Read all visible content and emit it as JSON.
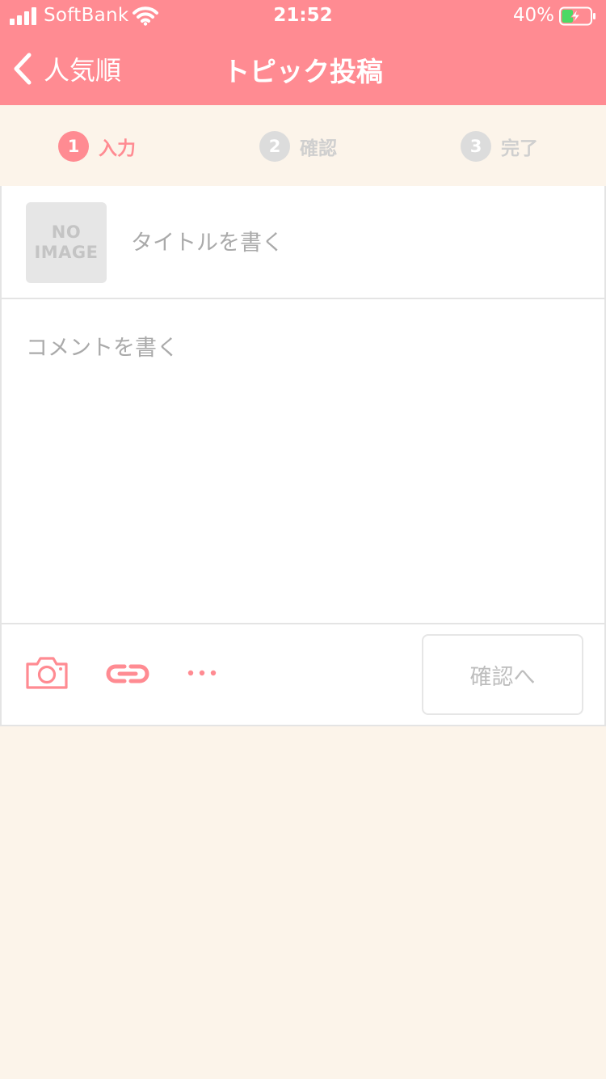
{
  "status_bar": {
    "carrier": "SoftBank",
    "time": "21:52",
    "battery_percent": "40%",
    "battery_level": 0.4,
    "charging": true
  },
  "nav": {
    "back_label": "人気順",
    "title": "トピック投稿"
  },
  "steps": [
    {
      "number": "1",
      "label": "入力",
      "state": "active"
    },
    {
      "number": "2",
      "label": "確認",
      "state": "inactive"
    },
    {
      "number": "3",
      "label": "完了",
      "state": "inactive"
    }
  ],
  "form": {
    "image_placeholder_line1": "NO",
    "image_placeholder_line2": "IMAGE",
    "title_placeholder": "タイトルを書く",
    "title_value": "",
    "comment_placeholder": "コメントを書く",
    "comment_value": ""
  },
  "toolbar": {
    "icons": [
      "camera-icon",
      "link-icon",
      "more-icon"
    ],
    "confirm_label": "確認へ"
  },
  "colors": {
    "accent": "#ff8b92",
    "background": "#fcf4ea",
    "disabled_text": "#bdbdbd",
    "inactive_step": "#dcdcdc"
  }
}
